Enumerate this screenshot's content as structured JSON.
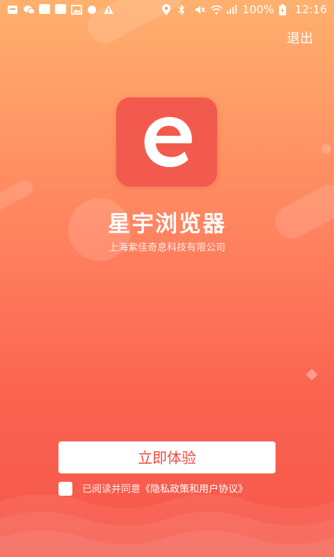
{
  "status_bar": {
    "battery": "100%",
    "time": "12:16",
    "left_icons": [
      "notification-icon",
      "wechat-icon",
      "square-icon",
      "square-icon",
      "image-icon",
      "circle-icon",
      "warning-icon"
    ],
    "right_icons": [
      "location-icon",
      "bluetooth-icon",
      "mute-icon",
      "wifi-icon",
      "signal-icon",
      "battery-icon"
    ]
  },
  "header": {
    "exit_label": "退出"
  },
  "app": {
    "logo_letter": "e",
    "name": "星宇浏览器",
    "company": "上海紫佳奇息科技有限公司"
  },
  "actions": {
    "start_label": "立即体验"
  },
  "agreement": {
    "prefix": "已阅读并同意",
    "link": "《隐私政策和用户协议》"
  },
  "colors": {
    "logo_bg": "#f25a4d",
    "accent": "#f14b3f"
  }
}
